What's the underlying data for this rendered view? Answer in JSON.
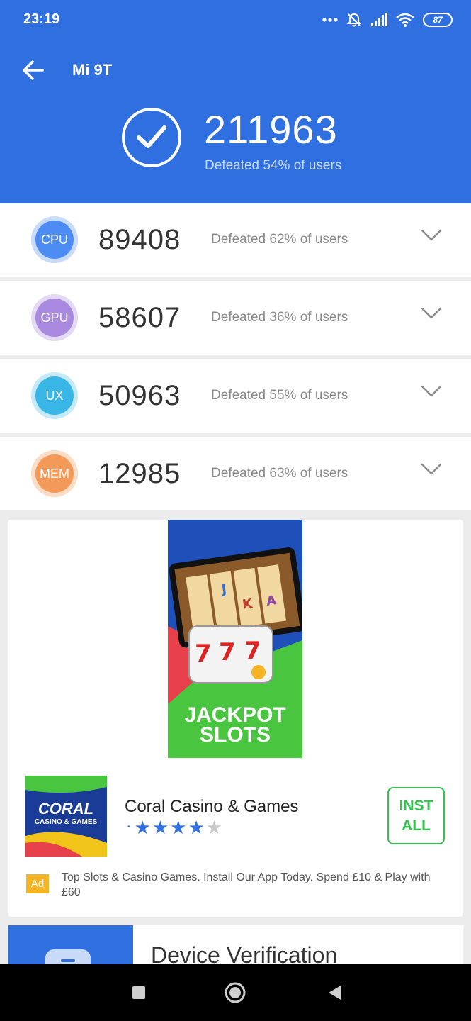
{
  "status_bar": {
    "time": "23:19",
    "icons": [
      "more-dots-icon",
      "notifications-off-icon",
      "signal-icon",
      "wifi-icon"
    ],
    "battery": "87"
  },
  "header": {
    "back_icon": "arrow-left-icon",
    "title": "Mi 9T",
    "total_score": "211963",
    "total_sub": "Defeated 54% of users",
    "check_icon": "checkmark-icon"
  },
  "scores": [
    {
      "label": "CPU",
      "score": "89408",
      "sub": "Defeated 62% of users",
      "color": "#4d8cf2",
      "ring": "#c8dbfb"
    },
    {
      "label": "GPU",
      "score": "58607",
      "sub": "Defeated 36% of users",
      "color": "#a98ae0",
      "ring": "#e3d9f5"
    },
    {
      "label": "UX",
      "score": "50963",
      "sub": "Defeated 55% of users",
      "color": "#38b6e6",
      "ring": "#c4e9f8"
    },
    {
      "label": "MEM",
      "score": "12985",
      "sub": "Defeated 63% of users",
      "color": "#f39a5a",
      "ring": "#fbdcc5"
    }
  ],
  "ad": {
    "banner_text_1": "JACKPOT",
    "banner_text_2": "SLOTS",
    "logo_text_1": "CORAL",
    "logo_text_2": "CASINO & GAMES",
    "app_name": "Coral Casino & Games",
    "rating": 4,
    "rating_max": 5,
    "install_label_1": "INST",
    "install_label_2": "ALL",
    "badge": "Ad",
    "description": "Top Slots & Casino Games. Install Our App Today. Spend £10 & Play with £60"
  },
  "device_verification": {
    "title": "Device Verification"
  },
  "nav": {
    "recents_icon": "square-icon",
    "home_icon": "circle-icon",
    "back_icon": "triangle-back-icon"
  },
  "colors": {
    "primary": "#2f6fe0",
    "install_green": "#33c24d",
    "ad_badge": "#f5b425"
  }
}
